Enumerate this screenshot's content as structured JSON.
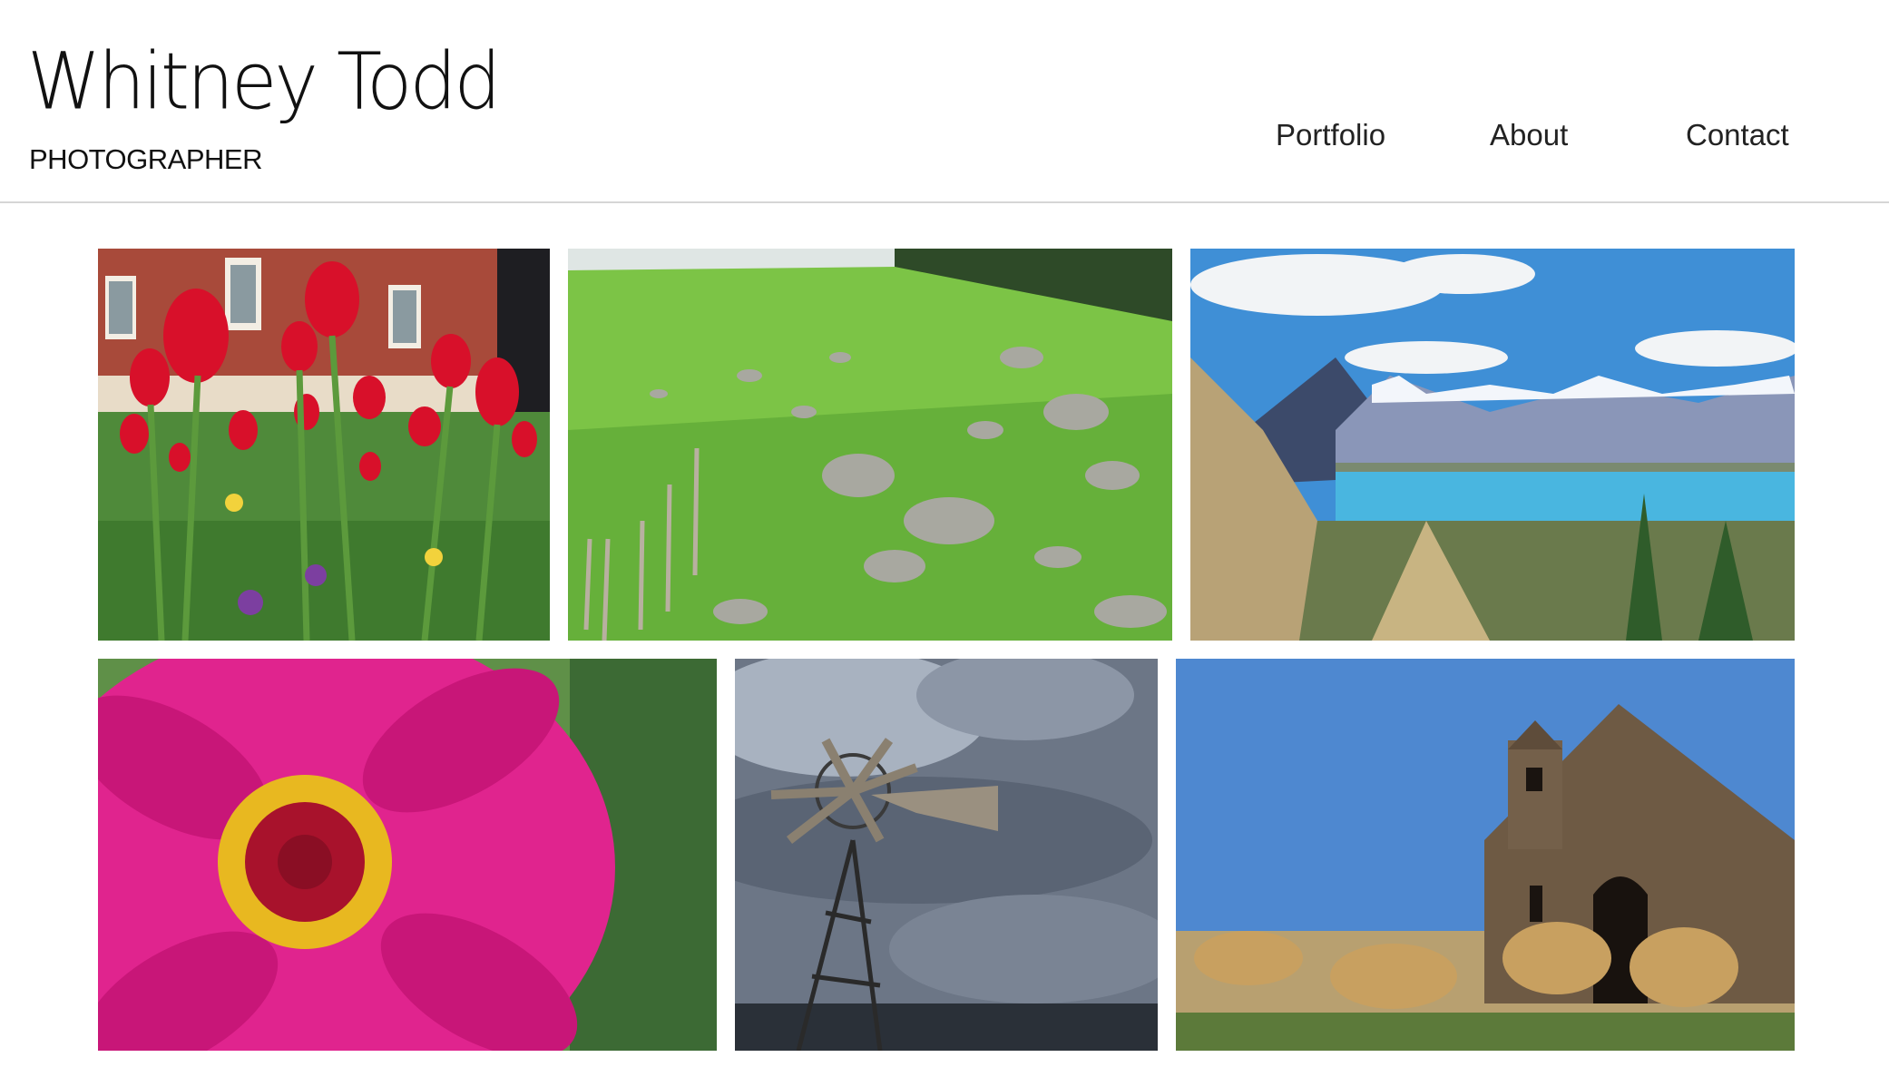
{
  "site": {
    "logo_name": "Whitney Todd",
    "logo_tagline": "PHOTOGRAPHER"
  },
  "nav": {
    "items": [
      {
        "label": "Portfolio"
      },
      {
        "label": "About"
      },
      {
        "label": "Contact"
      }
    ]
  },
  "gallery": {
    "photos": [
      {
        "subject": "red-tulips"
      },
      {
        "subject": "rocky-hillside-pasture"
      },
      {
        "subject": "mountain-lake-view"
      },
      {
        "subject": "pink-zinnia-flower"
      },
      {
        "subject": "windmill-stormy-sky"
      },
      {
        "subject": "stone-chapel"
      }
    ]
  }
}
